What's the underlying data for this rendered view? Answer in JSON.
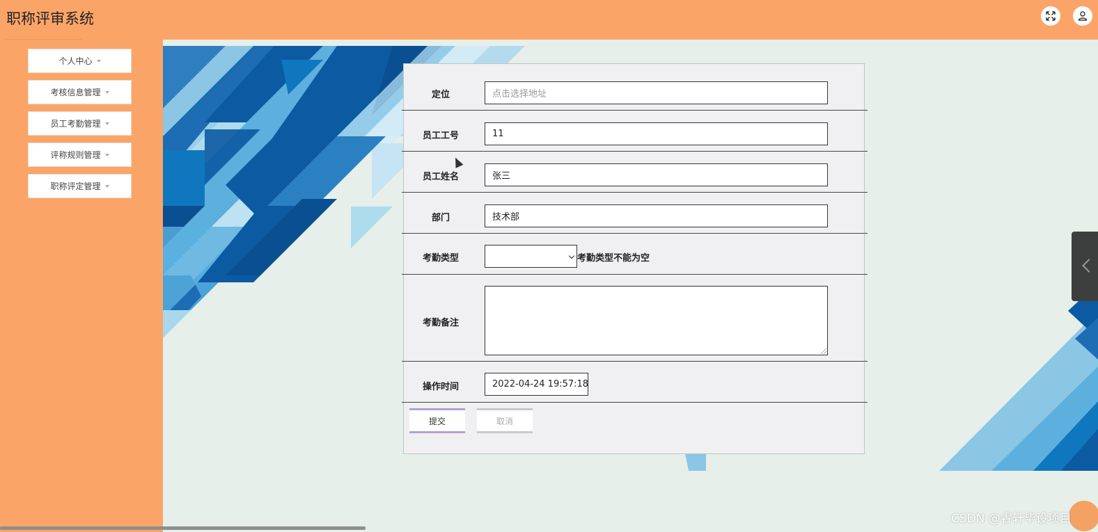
{
  "app": {
    "title": "职称评审系统"
  },
  "header": {
    "fullscreen_icon": "expand-arrows-icon",
    "user_icon": "user-icon"
  },
  "sidebar": {
    "items": [
      {
        "label": "个人中心"
      },
      {
        "label": "考核信息管理"
      },
      {
        "label": "员工考勤管理"
      },
      {
        "label": "评称规则管理"
      },
      {
        "label": "职称评定管理"
      }
    ]
  },
  "form": {
    "location": {
      "label": "定位",
      "placeholder": "点击选择地址",
      "value": ""
    },
    "employee_no": {
      "label": "员工工号",
      "value": "11"
    },
    "employee_name": {
      "label": "员工姓名",
      "value": "张三"
    },
    "department": {
      "label": "部门",
      "value": "技术部"
    },
    "attendance_type": {
      "label": "考勤类型",
      "value": "",
      "error": "考勤类型不能为空"
    },
    "attendance_note": {
      "label": "考勤备注",
      "value": ""
    },
    "operation_time": {
      "label": "操作时间",
      "value": "2022-04-24 19:57:18"
    },
    "submit_label": "提交",
    "cancel_label": "取消"
  },
  "watermark": "CSDN @睿轩毕设项目",
  "colors": {
    "header_bg": "#fba468",
    "sidebar_bg": "#fba468",
    "content_bg": "#e6efe9",
    "accent_blue": "#0b5aa2"
  }
}
